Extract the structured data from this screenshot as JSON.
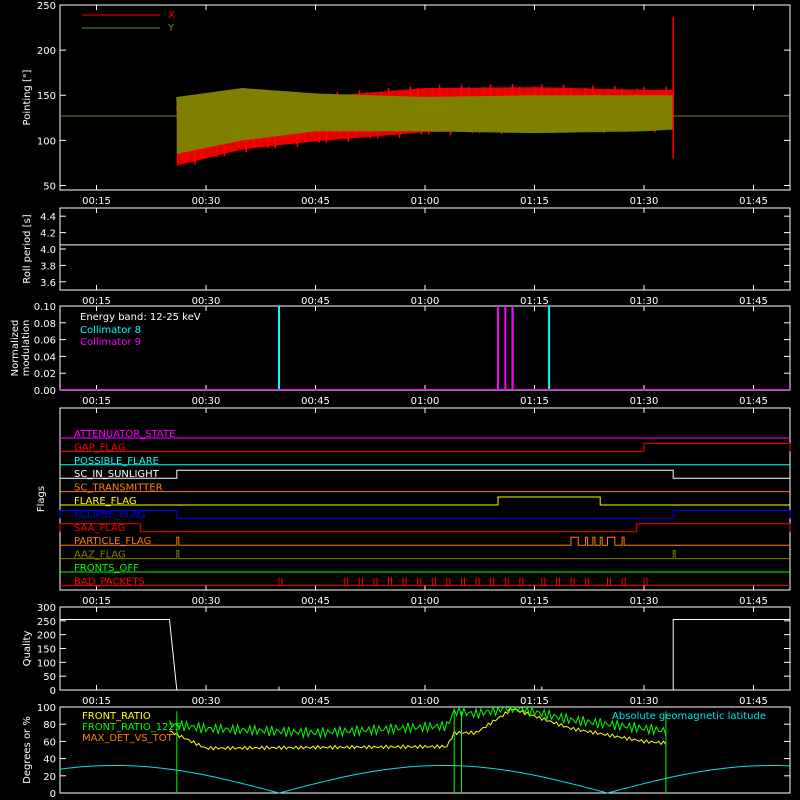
{
  "chart_data": [
    {
      "type": "area",
      "ylabel": "Pointing [\"]",
      "ylim": [
        45,
        250
      ],
      "y_ticks": [
        "50",
        "100",
        "150",
        "200",
        "250"
      ],
      "x_ticks": [
        "00:15",
        "00:30",
        "00:45",
        "01:00",
        "01:15",
        "01:30",
        "01:45"
      ],
      "reference_line": 127,
      "series": [
        {
          "name": "X",
          "color": "#ff0000",
          "t": [
            "00:26",
            "00:35",
            "00:45",
            "01:00",
            "01:15",
            "01:30",
            "01:34"
          ],
          "upper": [
            143,
            150,
            152,
            162,
            163,
            160,
            160
          ],
          "lower": [
            68,
            86,
            95,
            105,
            108,
            108,
            110
          ]
        },
        {
          "name": "Y",
          "color": "#808000",
          "t": [
            "00:26",
            "00:35",
            "00:45",
            "01:00",
            "01:15",
            "01:30",
            "01:34"
          ],
          "upper": [
            148,
            158,
            152,
            148,
            150,
            150,
            150
          ],
          "lower": [
            85,
            100,
            110,
            110,
            108,
            110,
            112
          ]
        }
      ],
      "end_spike": {
        "t": "01:34",
        "max": 237,
        "min": 80
      }
    },
    {
      "type": "line",
      "ylabel": "Roll period [s]",
      "ylim": [
        3.5,
        4.5
      ],
      "y_ticks": [
        "3.6",
        "3.8",
        "4.0",
        "4.2",
        "4.4"
      ],
      "x_ticks": [
        "00:15",
        "00:30",
        "00:45",
        "01:00",
        "01:15",
        "01:30",
        "01:45"
      ],
      "value": 4.05
    },
    {
      "type": "bar",
      "ylabel": "Normalized modulation",
      "ylim": [
        0,
        0.1
      ],
      "y_ticks": [
        "0.00",
        "0.02",
        "0.04",
        "0.06",
        "0.08",
        "0.10"
      ],
      "x_ticks": [
        "00:15",
        "00:30",
        "00:45",
        "01:00",
        "01:15",
        "01:30",
        "01:45"
      ],
      "annotation": "Energy band: 12-25 keV",
      "series": [
        {
          "name": "Collimator 8",
          "color": "#00ffff",
          "t": [
            "00:40",
            "01:12",
            "01:17"
          ]
        },
        {
          "name": "Collimator 9",
          "color": "#ff00ff",
          "t": [
            "01:10",
            "01:11",
            "01:12"
          ]
        }
      ]
    },
    {
      "type": "line",
      "ylabel": "Flags",
      "x_ticks": [
        "00:15",
        "00:30",
        "00:45",
        "01:00",
        "01:15",
        "01:30",
        "01:45"
      ],
      "flags": [
        {
          "name": "ATTENUATOR_STATE",
          "color": "#ff00ff",
          "segments": []
        },
        {
          "name": "SAA_FLAG_OFF",
          "label": "GAP_FLAG",
          "color": "#ff0000",
          "segments": [
            [
              "01:30",
              "01:50"
            ]
          ]
        },
        {
          "name": "POSSIBLE_FLARE",
          "color": "#00ffff",
          "segments": []
        },
        {
          "name": "SC_IN_SUNLIGHT",
          "color": "#ffffff",
          "segments": [
            [
              "00:26",
              "01:34"
            ]
          ]
        },
        {
          "name": "SC_TRANSMITTER",
          "color": "#ff8000",
          "segments": []
        },
        {
          "name": "FLARE_FLAG",
          "color": "#ffff00",
          "segments": [
            [
              "01:10",
              "01:24"
            ]
          ]
        },
        {
          "name": "ECLIPSE_FLAG",
          "color": "#0000ff",
          "segments": [
            [
              "00:10",
              "00:26"
            ],
            [
              "01:34",
              "01:50"
            ]
          ]
        },
        {
          "name": "SAA_FLAG",
          "color": "#ff0000",
          "segments": [
            [
              "00:10",
              "00:21"
            ],
            [
              "01:29",
              "01:50"
            ]
          ]
        },
        {
          "name": "PARTICLE_FLAG",
          "color": "#ff8000",
          "segments": [
            [
              "00:26",
              "00:26"
            ],
            [
              "01:20",
              "01:21"
            ],
            [
              "01:22",
              "01:22"
            ],
            [
              "01:23",
              "01:23"
            ],
            [
              "01:24",
              "01:24"
            ],
            [
              "01:25",
              "01:26"
            ],
            [
              "01:27",
              "01:27"
            ]
          ]
        },
        {
          "name": "AAZ_FLAG",
          "color": "#808000",
          "segments": [
            [
              "00:26",
              "00:26"
            ],
            [
              "01:34",
              "01:34"
            ]
          ]
        },
        {
          "name": "FRONTS_OFF",
          "color": "#00ff00",
          "segments": []
        },
        {
          "name": "BAD_PACKETS",
          "color": "#ff0000",
          "segments": []
        }
      ]
    },
    {
      "type": "line",
      "ylabel": "Quality",
      "ylim": [
        0,
        300
      ],
      "y_ticks": [
        "0",
        "50",
        "100",
        "150",
        "200",
        "250",
        "300"
      ],
      "x_ticks": [
        "00:15",
        "00:30",
        "00:45",
        "01:00",
        "01:15",
        "01:30",
        "01:45"
      ],
      "segments": [
        {
          "t": [
            "00:10",
            "00:25",
            "00:26"
          ],
          "values": [
            255,
            255,
            0
          ]
        },
        {
          "t": [
            "00:26",
            "01:34"
          ],
          "values": [
            0,
            0
          ]
        },
        {
          "t": [
            "01:34",
            "01:34",
            "01:50"
          ],
          "values": [
            0,
            255,
            255
          ]
        }
      ]
    },
    {
      "type": "line",
      "ylabel": "Degrees or %",
      "ylim": [
        0,
        100
      ],
      "y_ticks": [
        "0",
        "20",
        "40",
        "60",
        "80",
        "100"
      ],
      "legend_right": "Absolute geomagnetic latitude",
      "series": [
        {
          "name": "FRONT_RATIO",
          "color": "#ffff00",
          "t": [
            "00:25",
            "00:30",
            "00:45",
            "01:03",
            "01:04",
            "01:07",
            "01:12",
            "01:20",
            "01:30",
            "01:33"
          ],
          "values": [
            72,
            52,
            53,
            54,
            70,
            70,
            98,
            75,
            60,
            58
          ]
        },
        {
          "name": "FRONT_RATIO_1225",
          "color": "#00ff00",
          "t": [
            "00:25",
            "00:30",
            "00:45",
            "01:03",
            "01:04",
            "01:07",
            "01:12",
            "01:20",
            "01:30",
            "01:33"
          ],
          "values": [
            80,
            75,
            70,
            78,
            95,
            92,
            100,
            85,
            75,
            72
          ]
        },
        {
          "name": "MAX_DET_VS_TOT",
          "color": "#ff8000",
          "t": [],
          "values": []
        },
        {
          "name": "Absolute geomagnetic latitude",
          "color": "#00e5e5",
          "t": [
            "00:10",
            "00:20",
            "00:40",
            "00:55",
            "01:10",
            "01:25",
            "01:40",
            "01:50"
          ],
          "values": [
            25,
            33,
            0,
            28,
            32,
            0,
            28,
            32
          ]
        }
      ]
    }
  ]
}
